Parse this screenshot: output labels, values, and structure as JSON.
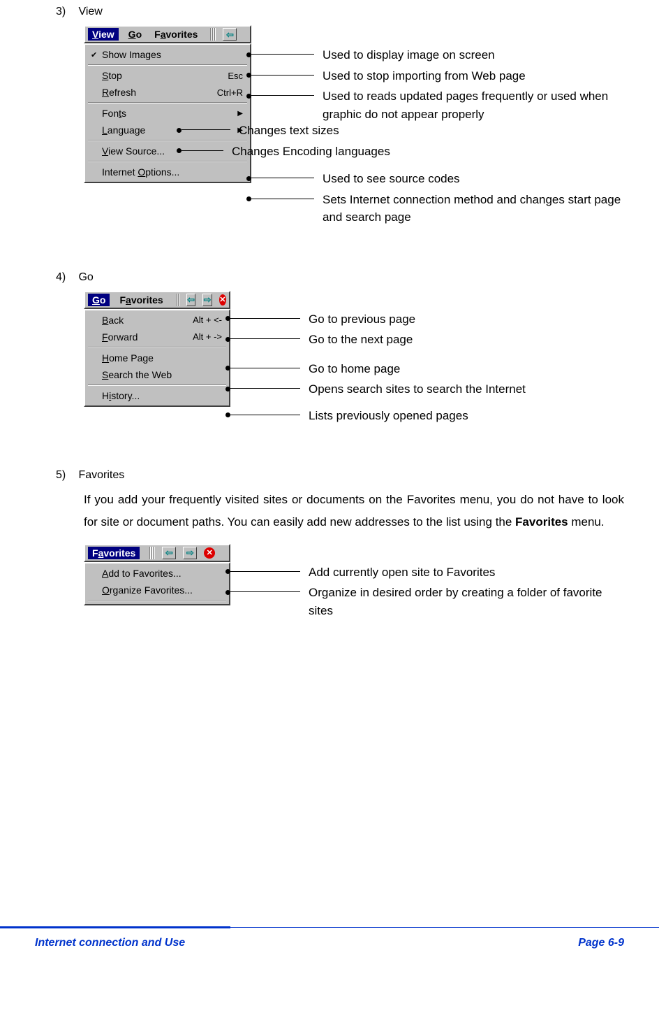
{
  "sections": {
    "view": {
      "num": "3)",
      "title": "View"
    },
    "go": {
      "num": "4)",
      "title": "Go"
    },
    "favorites": {
      "num": "5)",
      "title": "Favorites"
    }
  },
  "viewMenu": {
    "toolbar": {
      "view": "View",
      "go": "Go",
      "favorites": "Favorites"
    },
    "items": {
      "showImages": {
        "label": "Show Images"
      },
      "stop": {
        "label": "Stop",
        "shortcut": "Esc"
      },
      "refresh": {
        "label": "Refresh",
        "shortcut": "Ctrl+R"
      },
      "fonts": {
        "label": "Fonts"
      },
      "language": {
        "label": "Language"
      },
      "viewSource": {
        "label": "View Source..."
      },
      "internetOptions": {
        "label": "Internet Options..."
      }
    }
  },
  "viewAnnotations": {
    "showImages": "Used to display image on screen",
    "stop": "Used to stop importing from Web page",
    "refresh": "Used to reads updated pages frequently or used when graphic do not appear properly",
    "fonts": "Changes text sizes",
    "language": "Changes Encoding languages",
    "viewSource": "Used to see source codes",
    "internetOptions": "Sets Internet connection method and changes start page and search page"
  },
  "goMenu": {
    "toolbar": {
      "go": "Go",
      "favorites": "Favorites"
    },
    "items": {
      "back": {
        "label": "Back",
        "shortcut": "Alt + <-"
      },
      "forward": {
        "label": "Forward",
        "shortcut": "Alt + ->"
      },
      "homePage": {
        "label": "Home Page"
      },
      "searchWeb": {
        "label": "Search the Web"
      },
      "history": {
        "label": "History..."
      }
    }
  },
  "goAnnotations": {
    "back": "Go to previous page",
    "forward": "Go to the next page",
    "homePage": "Go to home page",
    "searchWeb": "Opens search sites to search the Internet",
    "history": "Lists previously opened pages"
  },
  "favoritesBody": {
    "p1a": "If you add your frequently visited sites or documents on the Favorites menu, you do not have to look for site or document paths. You can easily add new addresses to the list using the ",
    "bold": "Favorites",
    "p1b": " menu."
  },
  "favMenu": {
    "toolbar": {
      "favorites": "Favorites"
    },
    "items": {
      "add": {
        "label": "Add to Favorites..."
      },
      "organize": {
        "label": "Organize Favorites..."
      }
    }
  },
  "favAnnotations": {
    "add": "Add currently open site to Favorites",
    "organize": "Organize in desired order by creating a folder of favorite sites"
  },
  "footer": {
    "left": "Internet connection and Use",
    "right": "Page 6-9"
  }
}
